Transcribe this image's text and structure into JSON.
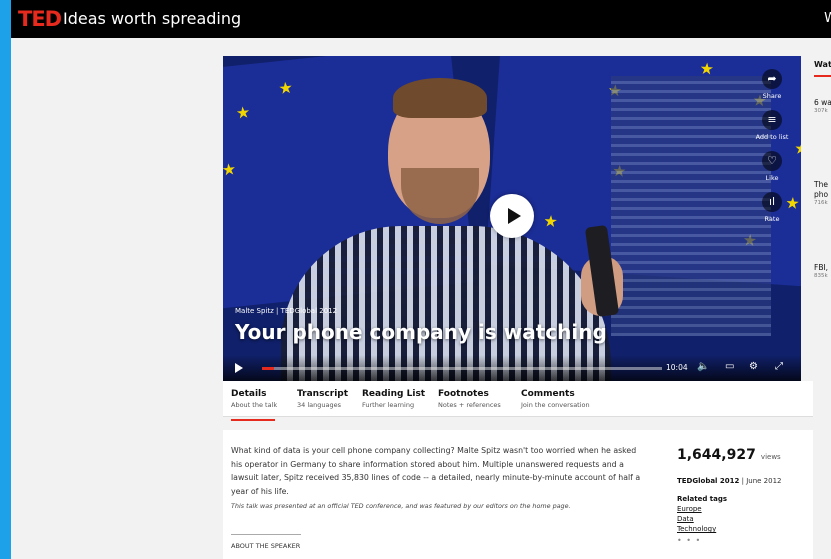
{
  "header": {
    "logo": "TED",
    "tagline": "Ideas worth spreading",
    "right_text": "W"
  },
  "video": {
    "speaker_event": "Malte Spitz | TEDGlobal 2012",
    "title": "Your phone company is watching",
    "duration": "10:04",
    "progress_percent": 3,
    "actions": [
      {
        "label": "Share",
        "icon": "share-icon"
      },
      {
        "label": "Add to list",
        "icon": "add-to-list-icon"
      },
      {
        "label": "Like",
        "icon": "heart-icon"
      },
      {
        "label": "Rate",
        "icon": "rate-icon"
      }
    ]
  },
  "tabs": [
    {
      "title": "Details",
      "sub": "About the talk"
    },
    {
      "title": "Transcript",
      "sub": "34 languages"
    },
    {
      "title": "Reading List",
      "sub": "Further learning"
    },
    {
      "title": "Footnotes",
      "sub": "Notes + references"
    },
    {
      "title": "Comments",
      "sub": "Join the conversation"
    }
  ],
  "details": {
    "description": "What kind of data is your cell phone company collecting? Malte Spitz wasn't too worried when he asked his operator in Germany to share information stored about him. Multiple unanswered requests and a lawsuit later, Spitz received 35,830 lines of code -- a detailed, nearly minute-by-minute account of half a year of his life.",
    "note": "This talk was presented at an official TED conference, and was featured by our editors on the home page.",
    "about_speaker": "ABOUT THE SPEAKER",
    "views": "1,644,927",
    "views_label": "views",
    "event": "TEDGlobal 2012",
    "date": "| June 2012",
    "related_tags_title": "Related tags",
    "tags": [
      "Europe",
      "Data",
      "Technology"
    ],
    "more": "• • •"
  },
  "watch_next": {
    "heading": "Wat",
    "items": [
      {
        "title": "6 wa",
        "title2": "",
        "views": "307k"
      },
      {
        "title": "The",
        "title2": "pho",
        "views": "716k"
      },
      {
        "title": "FBI,",
        "title2": "",
        "views": "835k"
      }
    ]
  },
  "colors": {
    "brand_red": "#e62b1e",
    "page_bg": "#f2f2f2",
    "outer_bg": "#1da1e8"
  }
}
